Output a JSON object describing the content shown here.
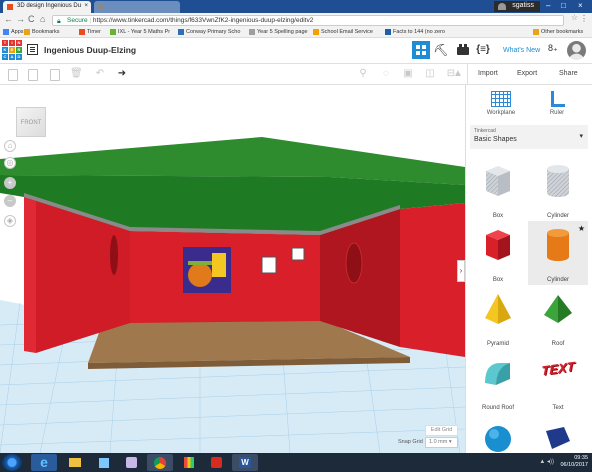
{
  "browser": {
    "tabs": [
      {
        "title": "3D design Ingenious Du"
      },
      {
        "title": ""
      }
    ],
    "user": "sgatiss",
    "nav": {
      "back": "←",
      "forward": "→",
      "reload": "C",
      "home": "⌂"
    },
    "secure_label": "Secure",
    "url": "https://www.tinkercad.com/things/f633VwnZfK2-ingenious-duup-elzing/editv2",
    "bookmarks": [
      {
        "label": "Apps",
        "color": "#4285f4"
      },
      {
        "label": "Bookmarks",
        "color": "#e8a317"
      },
      {
        "label": "Timer",
        "color": "#e84c1f"
      },
      {
        "label": "IXL - Year 5 Maths Pr",
        "color": "#68b42e"
      },
      {
        "label": "Conway Primary Scho",
        "color": "#2f6fb8"
      },
      {
        "label": "Year 5 Spelling page",
        "color": "#9e9e9e"
      },
      {
        "label": "School Email Service",
        "color": "#f4a000"
      },
      {
        "label": "Facts to 144 (no zero",
        "color": "#1e5fa8"
      },
      {
        "label": "Other bookmarks",
        "color": "#e8a317"
      }
    ]
  },
  "app": {
    "logo_letters": [
      "TIN",
      "KER",
      "CAD"
    ],
    "project_title": "Ingenious Duup-Elzing",
    "whats_new": "What's New",
    "actions": {
      "import": "Import",
      "export": "Export",
      "share": "Share"
    }
  },
  "workspace": {
    "view_cube": "FRONT",
    "edit_grid": "Edit Grid",
    "snap_grid_label": "Snap Grid",
    "snap_grid_value": "1.0 mm ▾",
    "colors": {
      "roof": "#2e8b2e",
      "wall": "#d81f2a",
      "floor": "#a0784e",
      "grid": "#b9d9ee"
    }
  },
  "panel": {
    "views": [
      {
        "label": "Workplane"
      },
      {
        "label": "Ruler"
      }
    ],
    "library_small": "Tinkercad",
    "library": "Basic Shapes",
    "shapes": [
      {
        "label": "Box",
        "kind": "box-hole"
      },
      {
        "label": "Cylinder",
        "kind": "cyl-hole"
      },
      {
        "label": "Box",
        "kind": "box-red"
      },
      {
        "label": "Cylinder",
        "kind": "cyl-orange"
      },
      {
        "label": "Pyramid",
        "kind": "pyramid"
      },
      {
        "label": "Roof",
        "kind": "roof"
      },
      {
        "label": "Round Roof",
        "kind": "roundroof"
      },
      {
        "label": "Text",
        "kind": "text"
      }
    ],
    "text_shape_word": "TEXT"
  },
  "taskbar": {
    "time": "09:35",
    "date": "06/10/2017"
  }
}
